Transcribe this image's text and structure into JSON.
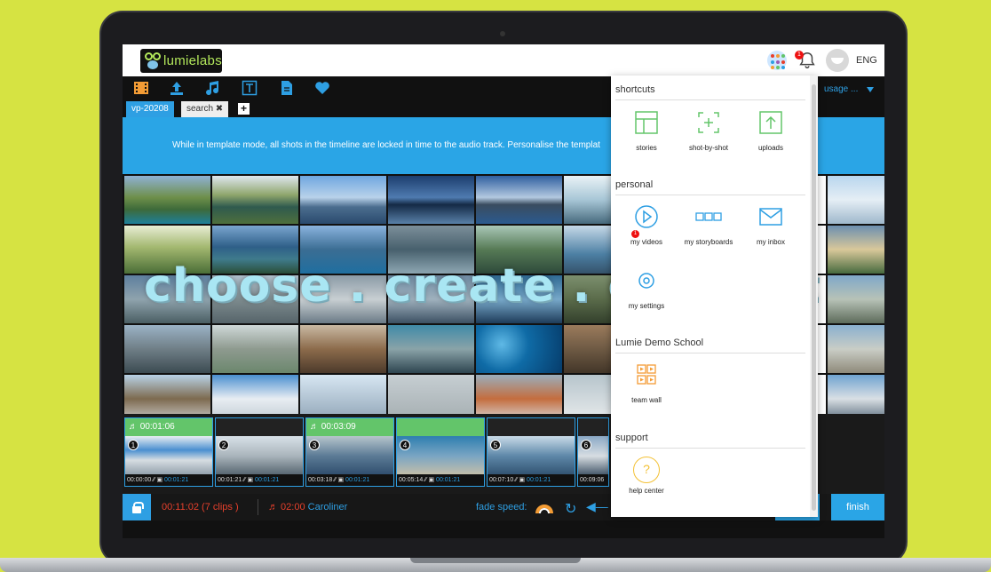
{
  "app": {
    "logo_text": "lumielabs",
    "language": "ENG",
    "notification_count": "1"
  },
  "toolbar": {
    "usage_label": "usage ..."
  },
  "tabs": {
    "active": "vp-20208",
    "search": "search ✖",
    "add": "+"
  },
  "banner": {
    "text": "While in template mode, all shots in the timeline are locked in time to the audio track. Personalise the templat"
  },
  "slogan": "choose . create . connect",
  "timeline": {
    "clips": [
      {
        "number": "1",
        "head": "♬ 00:01:06",
        "music": true,
        "start": "00:00:00",
        "length": "00:01:21"
      },
      {
        "number": "2",
        "head": "",
        "music": false,
        "start": "00:01:21",
        "length": "00:01:21"
      },
      {
        "number": "3",
        "head": "♬ 00:03:09",
        "music": true,
        "start": "00:03:18",
        "length": "00:01:21"
      },
      {
        "number": "4",
        "head": "",
        "music": true,
        "start": "00:05:14",
        "length": "00:01:21"
      },
      {
        "number": "5",
        "head": "",
        "music": false,
        "start": "00:07:10",
        "length": "00:01:21"
      },
      {
        "number": "6",
        "head": "",
        "music": false,
        "start": "00:09:06",
        "length": ""
      }
    ]
  },
  "bottom": {
    "duration": "00:11:02  (7 clips )",
    "music_time": "♬ 02:00",
    "music_name": "Caroliner",
    "fade_label": "fade speed:",
    "finish": "finish"
  },
  "panel": {
    "shortcuts_title": "shortcuts",
    "shortcuts": [
      "stories",
      "shot-by-shot",
      "uploads"
    ],
    "personal_title": "personal",
    "personal": [
      "my videos",
      "my storyboards",
      "my inbox",
      "my settings"
    ],
    "videos_badge": "1",
    "school_title": "Lumie Demo School",
    "school": [
      "team wall"
    ],
    "support_title": "support",
    "support": [
      "help center"
    ],
    "help_symbol": "?"
  },
  "colors": {
    "accent": "#2aa5e6",
    "green": "#63c56a",
    "orange": "#f39c35",
    "red": "#e8402c",
    "background": "#d6e342"
  }
}
